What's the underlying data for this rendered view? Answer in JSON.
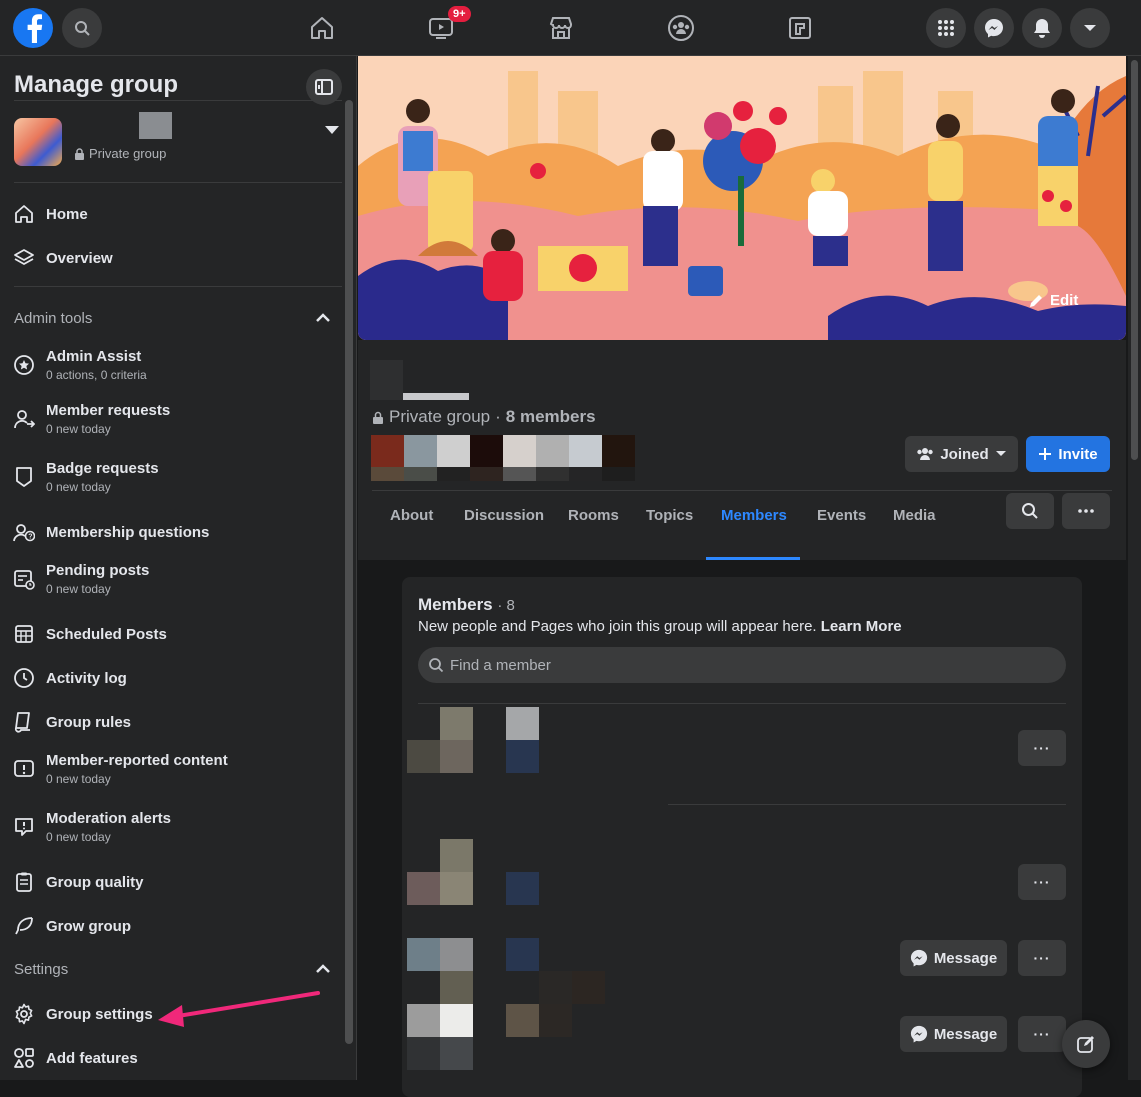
{
  "topbar": {
    "icons": [
      "facebook-logo",
      "search-icon",
      "home-icon",
      "watch-icon",
      "marketplace-icon",
      "groups-icon",
      "gaming-icon",
      "menu-grid-icon",
      "messenger-icon",
      "notifications-icon",
      "account-caret-icon"
    ],
    "watch_badge": "9+"
  },
  "sidebar": {
    "title": "Manage group",
    "group_privacy": "Private group",
    "nav": [
      {
        "label": "Home",
        "icon": "home-icon"
      },
      {
        "label": "Overview",
        "icon": "layers-icon"
      }
    ],
    "admin_tools_header": "Admin tools",
    "admin_tools": [
      {
        "label": "Admin Assist",
        "sub": "0 actions, 0 criteria",
        "icon": "admin-assist-icon"
      },
      {
        "label": "Member requests",
        "sub": "0 new today",
        "icon": "member-requests-icon"
      },
      {
        "label": "Badge requests",
        "sub": "0 new today",
        "icon": "badge-icon"
      },
      {
        "label": "Membership questions",
        "sub": "",
        "icon": "questions-icon"
      },
      {
        "label": "Pending posts",
        "sub": "0 new today",
        "icon": "pending-posts-icon"
      },
      {
        "label": "Scheduled Posts",
        "sub": "",
        "icon": "calendar-icon"
      },
      {
        "label": "Activity log",
        "sub": "",
        "icon": "clock-icon"
      },
      {
        "label": "Group rules",
        "sub": "",
        "icon": "rules-icon"
      },
      {
        "label": "Member-reported content",
        "sub": "0 new today",
        "icon": "report-icon"
      },
      {
        "label": "Moderation alerts",
        "sub": "0 new today",
        "icon": "alert-icon"
      },
      {
        "label": "Group quality",
        "sub": "",
        "icon": "clipboard-icon"
      },
      {
        "label": "Grow group",
        "sub": "",
        "icon": "grow-icon"
      }
    ],
    "settings_header": "Settings",
    "settings": [
      {
        "label": "Group settings",
        "icon": "gear-icon"
      },
      {
        "label": "Add features",
        "icon": "shapes-icon"
      }
    ]
  },
  "main": {
    "cover_edit": "Edit",
    "privacy": "Private group",
    "separator": "·",
    "member_count": "8 members",
    "joined_label": "Joined",
    "invite_label": "Invite",
    "tabs": [
      "About",
      "Discussion",
      "Rooms",
      "Topics",
      "Members",
      "Events",
      "Media"
    ],
    "active_tab": "Members",
    "members_card": {
      "title": "Members",
      "count": "· 8",
      "subtitle": "New people and Pages who join this group will appear here.",
      "learn_more": "Learn More",
      "search_placeholder": "Find a member",
      "message_label": "Message",
      "more_label": "···"
    }
  },
  "colors": {
    "background": "#18191a",
    "surface": "#242526",
    "button": "#3a3b3c",
    "accent": "#2d88ff",
    "invite": "#2374e1",
    "annotation_arrow": "#f0287a"
  }
}
